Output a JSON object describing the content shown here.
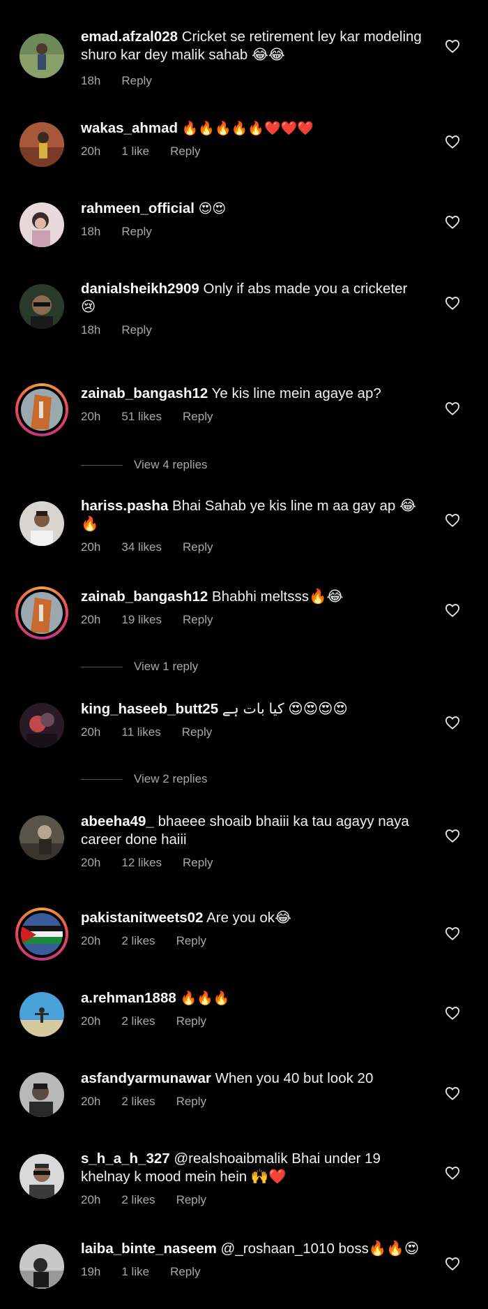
{
  "comments": [
    {
      "user": "emad.afzal028",
      "text": "Cricket se retirement ley kar modeling shuro kar dey malik sahab 😂😂",
      "time": "18h",
      "likes": "",
      "reply": "Reply"
    },
    {
      "user": "wakas_ahmad",
      "text": "🔥🔥🔥🔥🔥❤️❤️❤️",
      "time": "20h",
      "likes": "1 like",
      "reply": "Reply"
    },
    {
      "user": "rahmeen_official",
      "text": "😍😍",
      "time": "18h",
      "likes": "",
      "reply": "Reply"
    },
    {
      "user": "danialsheikh2909",
      "text": "Only if abs  made you a cricketer 😢",
      "time": "18h",
      "likes": "",
      "reply": "Reply"
    },
    {
      "user": "zainab_bangash12",
      "text": "Ye kis line mein agaye ap?",
      "time": "20h",
      "likes": "51 likes",
      "reply": "Reply",
      "view_replies": "View 4 replies"
    },
    {
      "user": "hariss.pasha",
      "text": "Bhai Sahab ye kis line m aa gay ap 😂🔥",
      "time": "20h",
      "likes": "34 likes",
      "reply": "Reply"
    },
    {
      "user": "zainab_bangash12",
      "text": "Bhabhi meltsss🔥😂",
      "time": "20h",
      "likes": "19 likes",
      "reply": "Reply",
      "view_replies": "View 1 reply"
    },
    {
      "user": "king_haseeb_butt25",
      "text": "کیا بات ہے 😍😍😍😍",
      "time": "20h",
      "likes": "11 likes",
      "reply": "Reply",
      "view_replies": "View 2 replies"
    },
    {
      "user": "abeeha49_",
      "text": "bhaeee shoaib bhaiii ka tau agayy naya career done haiii",
      "time": "20h",
      "likes": "12 likes",
      "reply": "Reply"
    },
    {
      "user": "pakistanitweets02",
      "text": "Are you ok😂",
      "time": "20h",
      "likes": "2 likes",
      "reply": "Reply"
    },
    {
      "user": "a.rehman1888",
      "text": "🔥🔥🔥",
      "time": "20h",
      "likes": "2 likes",
      "reply": "Reply"
    },
    {
      "user": "asfandyarmunawar",
      "text": "When you 40 but look 20",
      "time": "20h",
      "likes": "2 likes",
      "reply": "Reply"
    },
    {
      "user": "s_h_a_h_327",
      "text": "@realshoaibmalik Bhai under 19 khelnay k mood mein hein 🙌❤️",
      "time": "20h",
      "likes": "2 likes",
      "reply": "Reply"
    },
    {
      "user": "laiba_binte_naseem",
      "text": "@_roshaan_1010 boss🔥🔥😍",
      "time": "19h",
      "likes": "1 like",
      "reply": "Reply"
    }
  ],
  "colors": {
    "background": "#000000",
    "meta": "#a8a8a8",
    "ring_start": "#f2a13a",
    "ring_end": "#c13584"
  },
  "icons": {
    "like": "heart-outline-icon"
  }
}
